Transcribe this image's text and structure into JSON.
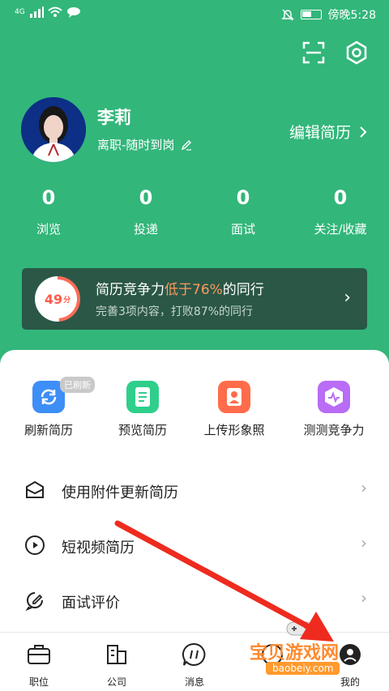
{
  "status_bar": {
    "network": "4G",
    "time": "傍晚5:28"
  },
  "profile": {
    "name": "李莉",
    "status": "离职-随时到岗",
    "edit_resume": "编辑简历"
  },
  "stats": [
    {
      "value": "0",
      "label": "浏览"
    },
    {
      "value": "0",
      "label": "投递"
    },
    {
      "value": "0",
      "label": "面试"
    },
    {
      "value": "0",
      "label": "关注/收藏"
    }
  ],
  "competitiveness": {
    "score": "49",
    "score_unit": "分",
    "title_prefix": "简历竞争力",
    "title_highlight": "低于76%",
    "title_suffix": "的同行",
    "subtitle": "完善3项内容，打败87%的同行"
  },
  "tools": [
    {
      "label": "刷新简历",
      "badge": "已刷新",
      "icon": "refresh-icon",
      "color": "#3e8ef7"
    },
    {
      "label": "预览简历",
      "icon": "document-icon",
      "color": "#2fcf8b"
    },
    {
      "label": "上传形象照",
      "icon": "portrait-icon",
      "color": "#ff6c4b"
    },
    {
      "label": "测测竞争力",
      "icon": "pulse-icon",
      "color": "#b96cf5"
    }
  ],
  "menu": [
    {
      "label": "使用附件更新简历",
      "icon": "envelope-icon"
    },
    {
      "label": "短视频简历",
      "icon": "play-icon"
    },
    {
      "label": "面试评价",
      "icon": "chat-edit-icon"
    }
  ],
  "tabs": [
    {
      "label": "职位",
      "icon": "briefcase-icon"
    },
    {
      "label": "公司",
      "icon": "building-icon"
    },
    {
      "label": "消息",
      "icon": "message-icon"
    },
    {
      "label": "",
      "icon": "discover-icon"
    },
    {
      "label": "我的",
      "icon": "profile-icon"
    }
  ],
  "watermark": {
    "text": "宝贝游戏网",
    "url": "baobeiy.com"
  },
  "colors": {
    "brand_green": "#32b67a",
    "highlight_orange": "#ff9a5d",
    "annotation_red": "#ee2b1e"
  }
}
